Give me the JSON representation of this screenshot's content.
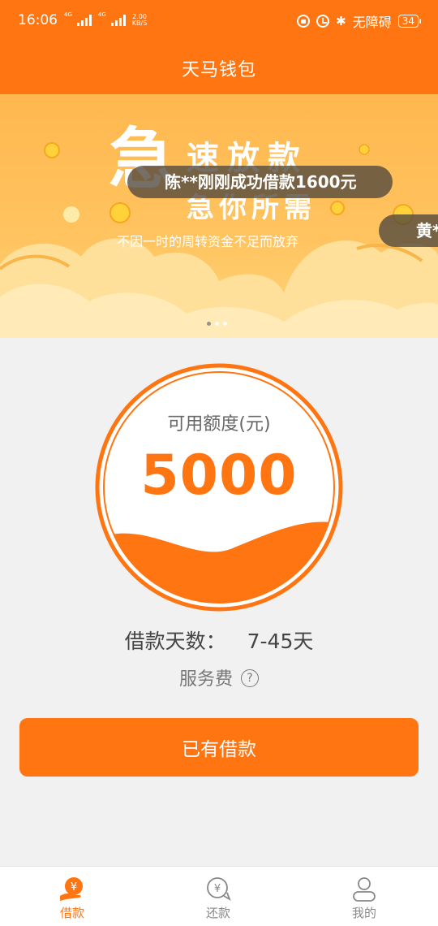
{
  "status_bar": {
    "time": "16:06",
    "network_1": "4G",
    "network_2": "4G",
    "speed_value": "2.00",
    "speed_unit": "KB/S",
    "accessibility": "无障碍",
    "battery": "34"
  },
  "header": {
    "title": "天马钱包"
  },
  "banner": {
    "big_char": "急",
    "title_line1": "速放款",
    "title_line2": "急你所需",
    "subtitle": "不因一时的周转资金不足而放弃",
    "ticker_main": "陈**刚刚成功借款1600元",
    "ticker_next": "黄*",
    "page_count": 3,
    "active_page": 0
  },
  "credit": {
    "label": "可用额度(元)",
    "amount": "5000",
    "fill_fraction": 0.2
  },
  "loan": {
    "days_label": "借款天数：",
    "days_value": "7-45天",
    "fee_label": "服务费",
    "help_glyph": "?"
  },
  "action": {
    "button_label": "已有借款"
  },
  "tabs": [
    {
      "label": "借款",
      "icon": "yen-hand-icon",
      "active": true
    },
    {
      "label": "还款",
      "icon": "yen-return-icon",
      "active": false
    },
    {
      "label": "我的",
      "icon": "user-icon",
      "active": false
    }
  ],
  "colors": {
    "primary": "#ff7512",
    "banner_light": "#ffd47c",
    "page_bg": "#f1f1f1"
  }
}
